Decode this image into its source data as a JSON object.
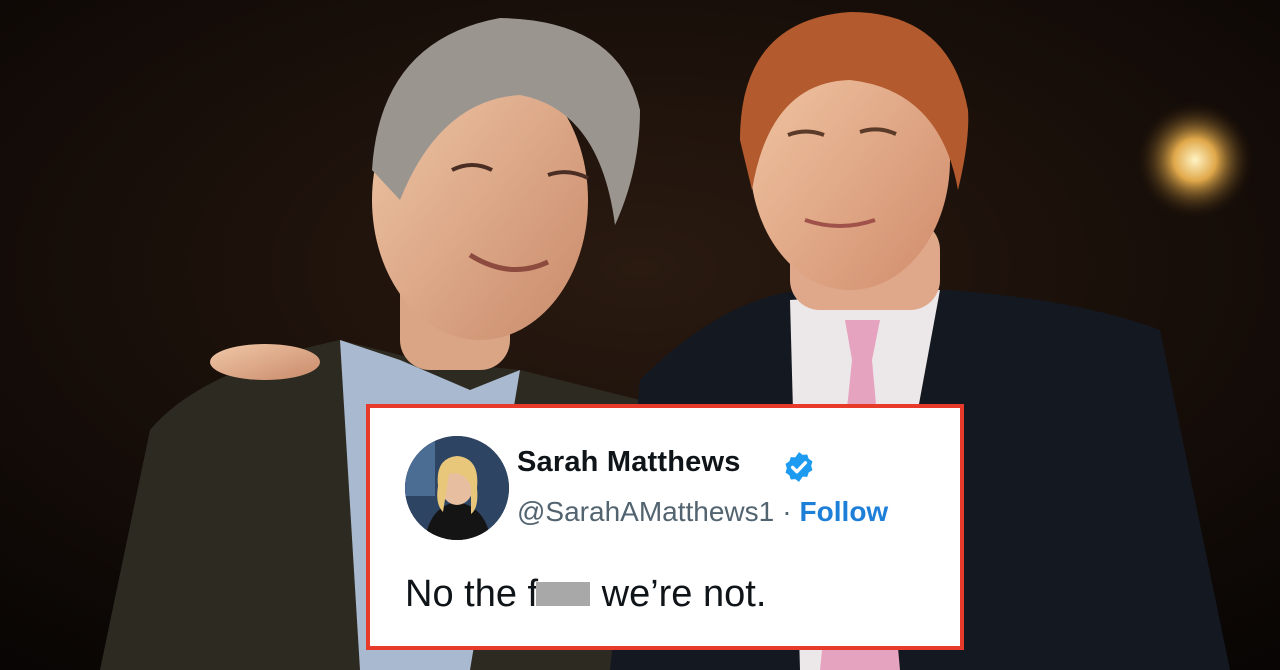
{
  "tweet": {
    "display_name": "Sarah Matthews",
    "handle": "@SarahAMatthews1",
    "separator": "·",
    "follow_label": "Follow",
    "text_before_censor": "No the f",
    "text_after_censor": " we’re not.",
    "verified": true,
    "follow_color": "#1d7fd8",
    "border_color": "#e83a2a"
  },
  "icons": {
    "verified": "verified-badge-icon"
  }
}
